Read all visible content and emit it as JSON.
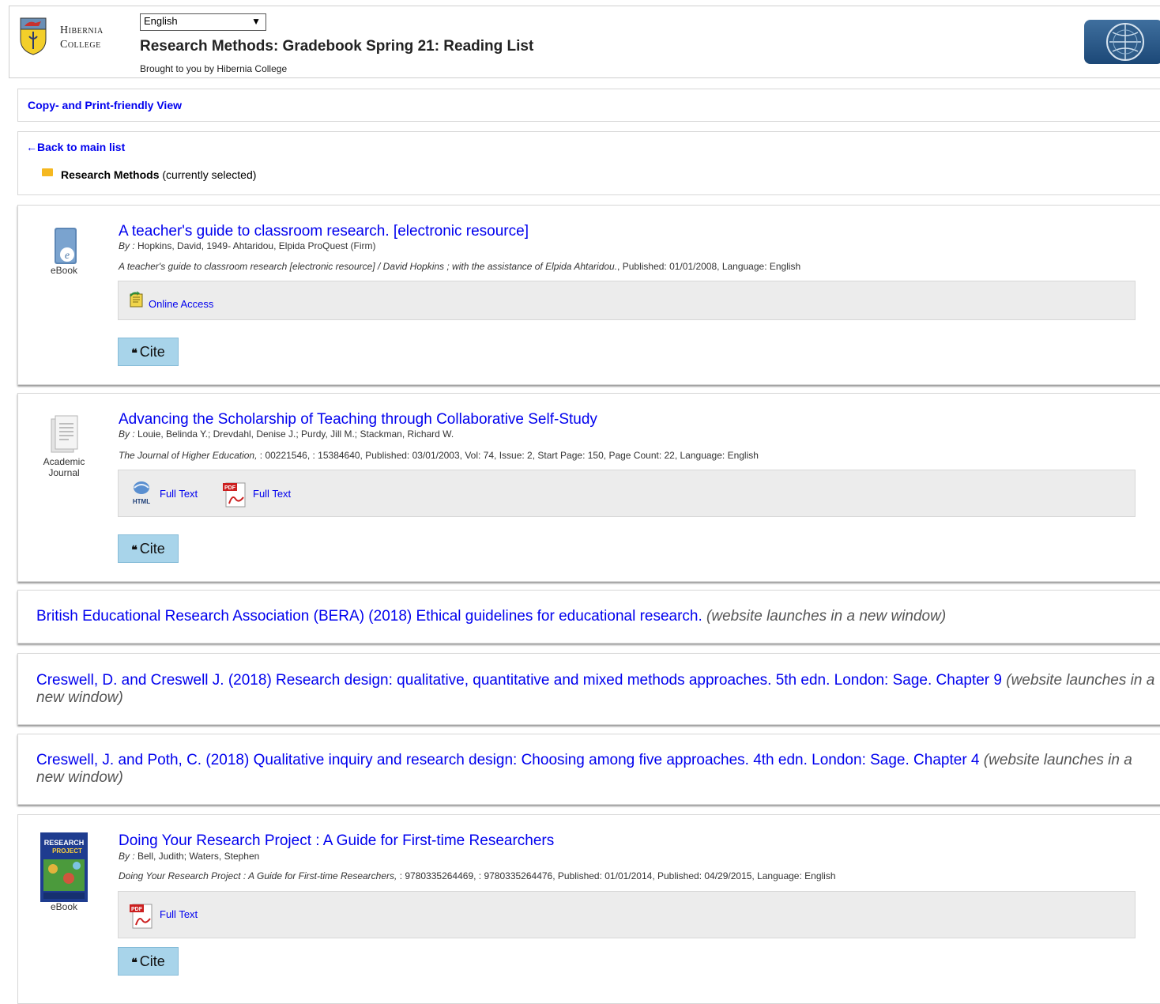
{
  "header": {
    "college_name_line1": "Hibernia",
    "college_name_line2": "College",
    "language_selected": "English",
    "title": "Research Methods: Gradebook Spring 21: Reading List",
    "brought_by": "Brought to you by Hibernia College"
  },
  "print_view_label": "Copy- and Print-friendly View",
  "navigation": {
    "back_label": "←Back to main list",
    "folder_name": "Research Methods",
    "folder_status": " (currently selected)"
  },
  "items": [
    {
      "type_label": "eBook",
      "title": "A teacher's guide to classroom research. [electronic resource]",
      "by_prefix": "By :",
      "by_text": " Hopkins, David, 1949- Ahtaridou, Elpida ProQuest (Firm)",
      "meta_italic": "A teacher's guide to classroom research [electronic resource] / David Hopkins ; with the assistance of Elpida Ahtaridou.",
      "meta_rest": ", Published: 01/01/2008, Language: English",
      "links": [
        "Online Access"
      ],
      "cite_label": "Cite"
    },
    {
      "type_label_line1": "Academic",
      "type_label_line2": "Journal",
      "title": "Advancing the Scholarship of Teaching through Collaborative Self-Study",
      "by_prefix": "By :",
      "by_text": " Louie, Belinda Y.; Drevdahl, Denise J.; Purdy, Jill M.; Stackman, Richard W.",
      "meta_italic": "The Journal of Higher Education,",
      "meta_rest": " : 00221546, : 15384640, Published: 03/01/2003, Vol: 74, Issue: 2, Start Page: 150, Page Count: 22, Language: English",
      "links": [
        "Full Text",
        "Full Text"
      ],
      "html_badge": "HTML",
      "pdf_badge": "PDF",
      "cite_label": "Cite"
    },
    {
      "type_label": "eBook",
      "title": "Doing Your Research Project : A Guide for First-time Researchers",
      "by_prefix": "By :",
      "by_text": " Bell, Judith; Waters, Stephen",
      "meta_italic": "Doing Your Research Project : A Guide for First-time Researchers,",
      "meta_rest": " : 9780335264469, : 9780335264476, Published: 01/01/2014, Published: 04/29/2015, Language: English",
      "links": [
        "Full Text"
      ],
      "pdf_badge": "PDF",
      "cover_text_line1": "RESEARCH",
      "cover_text_line2": "PROJECT",
      "cite_label": "Cite"
    }
  ],
  "web_links": [
    {
      "text": "British Educational Research Association (BERA) (2018) Ethical guidelines for educational research.",
      "note": " (website launches in a new window)"
    },
    {
      "text": "Creswell, D. and Creswell J. (2018) Research design: qualitative, quantitative and mixed methods approaches. 5th edn. London: Sage. Chapter 9",
      "note": " (website launches in a new window)"
    },
    {
      "text": "Creswell, J. and Poth, C. (2018) Qualitative inquiry and research design: Choosing among five approaches. 4th edn. London: Sage. Chapter 4",
      "note": " (website launches in a new window)"
    }
  ],
  "colors": {
    "link": "#0000ee",
    "cite_button": "#a8d4ea",
    "access_box": "#ececec",
    "folder": "#f5b820"
  }
}
